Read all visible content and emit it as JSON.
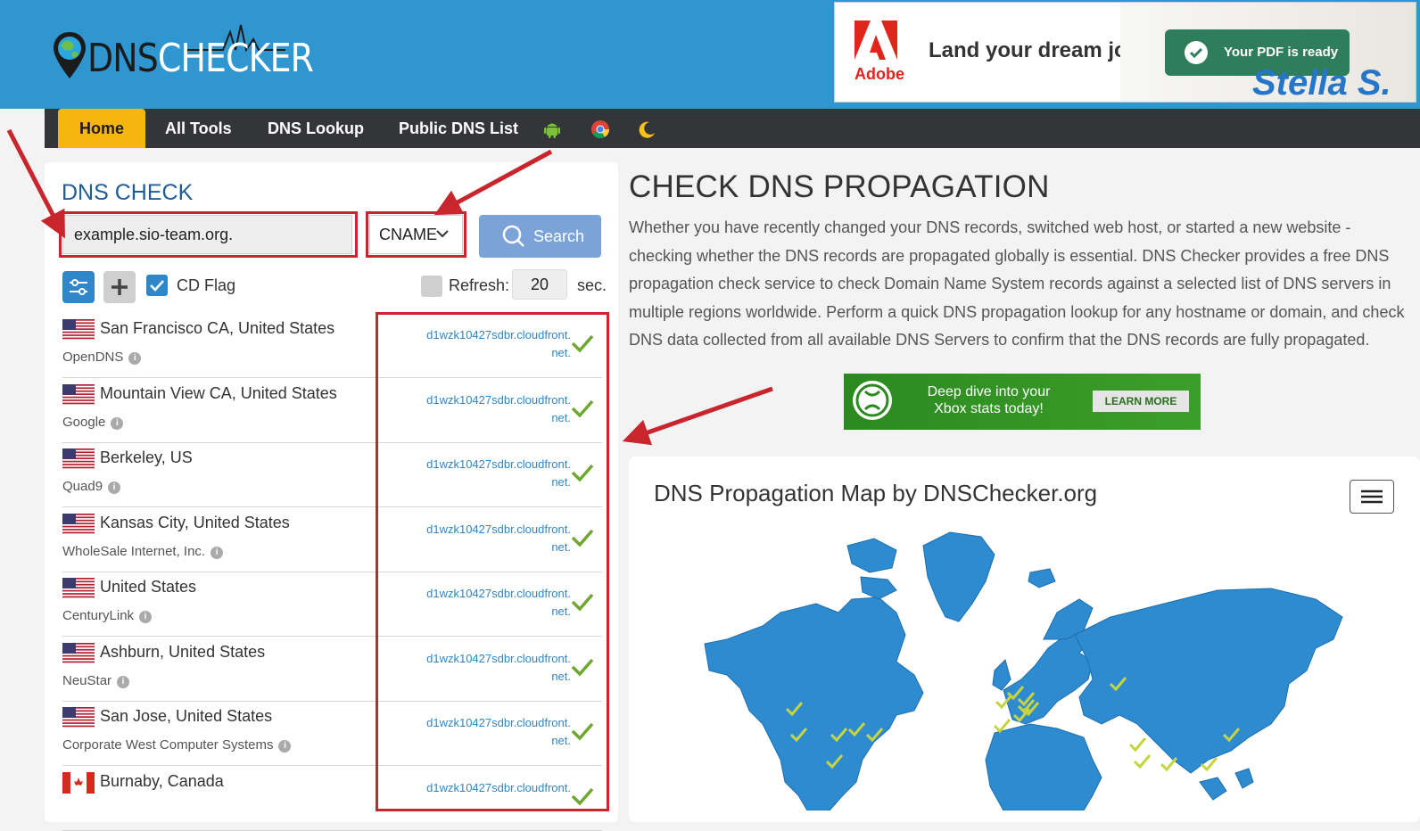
{
  "header": {
    "logo_dark": "DNS",
    "logo_light": "CHECKER"
  },
  "ad_top": {
    "brand": "Adobe",
    "headline": "Land your dream job.",
    "pill": "Your PDF is ready",
    "script": "Stella S."
  },
  "nav": {
    "items": [
      "Home",
      "All Tools",
      "DNS Lookup",
      "Public DNS List"
    ],
    "icons": [
      "android-icon",
      "chrome-icon",
      "moon-icon"
    ]
  },
  "dns_check": {
    "title": "DNS CHECK",
    "domain_value": "example.sio-team.org.",
    "record_type": "CNAME",
    "search_label": "Search",
    "cd_flag_label": "CD Flag",
    "refresh_label": "Refresh:",
    "refresh_value": "20",
    "refresh_unit": "sec."
  },
  "results": [
    {
      "location": "San Francisco CA, United States",
      "provider": "OpenDNS",
      "flag": "us",
      "result_line1": "d1wzk10427sdbr.cloudfront.",
      "result_line2": "net."
    },
    {
      "location": "Mountain View CA, United States",
      "provider": "Google",
      "flag": "us",
      "result_line1": "d1wzk10427sdbr.cloudfront.",
      "result_line2": "net."
    },
    {
      "location": "Berkeley, US",
      "provider": "Quad9",
      "flag": "us",
      "result_line1": "d1wzk10427sdbr.cloudfront.",
      "result_line2": "net."
    },
    {
      "location": "Kansas City, United States",
      "provider": "WholeSale Internet, Inc.",
      "flag": "us",
      "result_line1": "d1wzk10427sdbr.cloudfront.",
      "result_line2": "net."
    },
    {
      "location": "United States",
      "provider": "CenturyLink",
      "flag": "us",
      "result_line1": "d1wzk10427sdbr.cloudfront.",
      "result_line2": "net."
    },
    {
      "location": "Ashburn, United States",
      "provider": "NeuStar",
      "flag": "us",
      "result_line1": "d1wzk10427sdbr.cloudfront.",
      "result_line2": "net."
    },
    {
      "location": "San Jose, United States",
      "provider": "Corporate West Computer Systems",
      "flag": "us",
      "result_line1": "d1wzk10427sdbr.cloudfront.",
      "result_line2": "net."
    },
    {
      "location": "Burnaby, Canada",
      "provider": "",
      "flag": "ca",
      "result_line1": "d1wzk10427sdbr.cloudfront.",
      "result_line2": ""
    }
  ],
  "propagation": {
    "title": "CHECK DNS PROPAGATION",
    "description": "Whether you have recently changed your DNS records, switched web host, or started a new website - checking whether the DNS records are propagated globally is essential. DNS Checker provides a free DNS propagation check service to check Domain Name System records against a selected list of DNS servers in multiple regions worldwide. Perform a quick DNS propagation lookup for any hostname or domain, and check DNS data collected from all available DNS Servers to confirm that the DNS records are fully propagated."
  },
  "ad_mid": {
    "text_line1": "Deep dive into your",
    "text_line2": "Xbox stats today!",
    "button": "LEARN MORE"
  },
  "map": {
    "title": "DNS Propagation Map by DNSChecker.org"
  },
  "colors": {
    "header_blue": "#2f96d0",
    "nav_dark": "#333539",
    "nav_active": "#f7b60f",
    "accent_red": "#c8252c",
    "check_green": "#6fa82f",
    "map_blue": "#2f8bd0"
  }
}
